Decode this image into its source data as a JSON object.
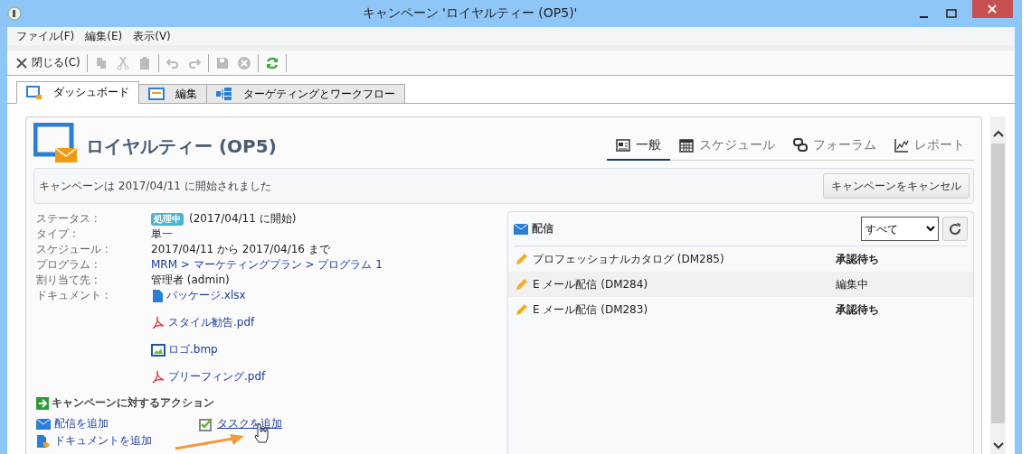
{
  "window": {
    "title": "キャンペーン 'ロイヤルティー (OP5)'"
  },
  "menu": [
    "ファイル(F)",
    "編集(E)",
    "表示(V)"
  ],
  "toolbar": [
    {
      "kind": "close",
      "label": "閉じる(C)",
      "disabled": false
    },
    {
      "kind": "copy",
      "disabled": true
    },
    {
      "kind": "cut",
      "disabled": true
    },
    {
      "kind": "paste",
      "disabled": true
    },
    {
      "kind": "undo",
      "disabled": true
    },
    {
      "kind": "redo",
      "disabled": true
    },
    {
      "kind": "save",
      "disabled": true
    },
    {
      "kind": "cancel",
      "disabled": true
    },
    {
      "kind": "refresh",
      "disabled": false
    }
  ],
  "tabs": [
    {
      "kind": "dashboard",
      "label": "ダッシュボード",
      "selected": true
    },
    {
      "kind": "edit",
      "label": "編集",
      "selected": false
    },
    {
      "kind": "workflow",
      "label": "ターゲティングとワークフロー",
      "selected": false
    }
  ],
  "header": {
    "title": "ロイヤルティー (OP5)",
    "views": [
      {
        "kind": "general",
        "label": "一般",
        "selected": true
      },
      {
        "kind": "schedule",
        "label": "スケジュール",
        "selected": false
      },
      {
        "kind": "forum",
        "label": "フォーラム",
        "selected": false
      },
      {
        "kind": "report",
        "label": "レポート",
        "selected": false
      }
    ]
  },
  "banner": {
    "message": "キャンペーンは 2017/04/11 に開始されました",
    "button": "キャンペーンをキャンセル"
  },
  "details": [
    {
      "kind": "status",
      "label": "ステータス :",
      "badge": "処理中",
      "value": "(2017/04/11 に開始)"
    },
    {
      "kind": "text",
      "label": "タイプ :",
      "value": "単一"
    },
    {
      "kind": "text",
      "label": "スケジュール :",
      "value": "2017/04/11 から 2017/04/16 まで"
    },
    {
      "kind": "link",
      "label": "プログラム :",
      "value": "MRM > マーケティングプラン > プログラム 1"
    },
    {
      "kind": "text",
      "label": "割り当て先 :",
      "value": "管理者 (admin)"
    }
  ],
  "documents": {
    "label": "ドキュメント :",
    "items": [
      {
        "kind": "xlsx",
        "name": "パッケージ.xlsx"
      },
      {
        "kind": "pdf",
        "name": "スタイル勧告.pdf"
      },
      {
        "kind": "bmp",
        "name": "ロゴ.bmp"
      },
      {
        "kind": "pdf",
        "name": "ブリーフィング.pdf"
      }
    ]
  },
  "actions": {
    "title": "キャンペーンに対するアクション",
    "items": [
      {
        "kind": "delivery",
        "label": "配信を追加",
        "hovered": false
      },
      {
        "kind": "task",
        "label": "タスクを追加",
        "hovered": true
      },
      {
        "kind": "document",
        "label": "ドキュメントを追加",
        "hovered": false
      }
    ]
  },
  "deliveries": {
    "title": "配信",
    "filter": "すべて",
    "rows": [
      {
        "name": "プロフェッショナルカタログ (DM285)",
        "status": "承認待ち",
        "pending": true
      },
      {
        "name": "E メール配信 (DM284)",
        "status": "編集中",
        "pending": false
      },
      {
        "name": "E メール配信 (DM283)",
        "status": "承認待ち",
        "pending": true
      }
    ]
  }
}
